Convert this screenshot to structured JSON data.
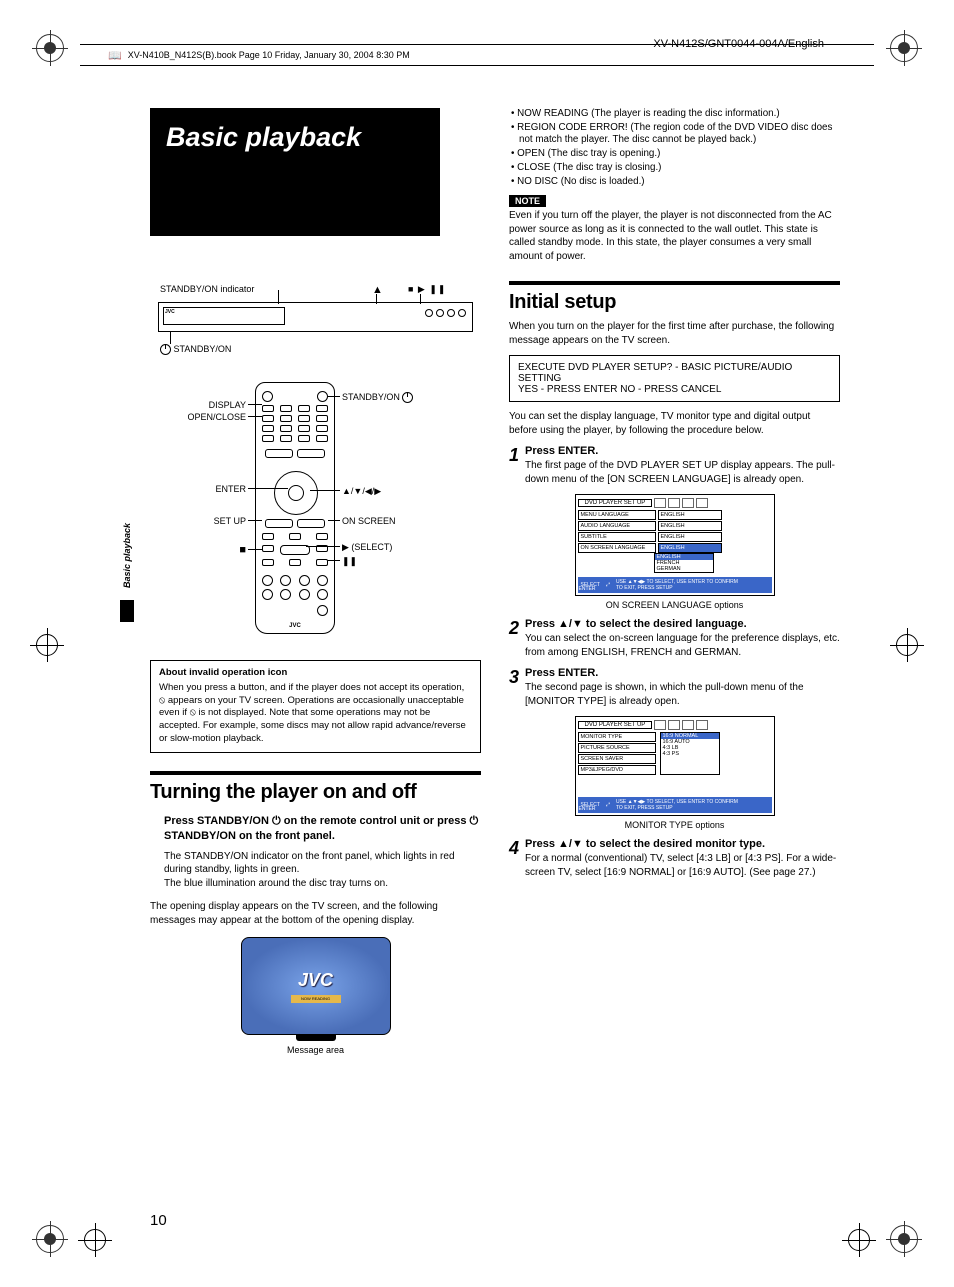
{
  "doc_header": {
    "book_line": "XV-N410B_N412S(B).book  Page 10  Friday, January 30, 2004  8:30 PM",
    "doc_id": "XV-N412S/GNT0044-004A/English"
  },
  "page_number": "10",
  "side_tab": "Basic playback",
  "title_box": "Basic playback",
  "device_labels": {
    "standby_indicator": "STANDBY/ON indicator",
    "eject": "▲",
    "stop_play_pause": "■ ▶ ❚❚",
    "standby_on": "STANDBY/ON",
    "brand": "JVC"
  },
  "remote_labels": {
    "display": "DISPLAY",
    "open_close": "OPEN/CLOSE",
    "enter": "ENTER",
    "set_up": "SET UP",
    "stop": "■",
    "standby_on": "STANDBY/ON",
    "arrows": "▲/▼/◀/▶",
    "on_screen": "ON SCREEN",
    "select": "▶ (SELECT)",
    "pause": "❚❚",
    "brand": "JVC"
  },
  "invalid_box": {
    "title": "About invalid operation icon",
    "body": "When you press a button, and if the player does not accept its operation, ⦸ appears on your TV screen. Operations are occasionally unacceptable even if ⦸ is not displayed. Note that some operations may not be accepted. For example, some discs may not allow rapid advance/reverse or slow-motion playback."
  },
  "turning": {
    "heading": "Turning the player on and off",
    "press_line": "Press STANDBY/ON ⏻ on the remote control unit or press ⏻ STANDBY/ON on the front panel.",
    "body1": "The STANDBY/ON indicator on the front panel, which lights in red during standby, lights in green.",
    "body2": "The blue illumination around the disc tray turns on.",
    "body3": "The opening display appears on the TV screen, and the following messages may appear at the bottom of the opening display.",
    "tv_logo": "JVC",
    "tv_msg": "NOW READING",
    "tv_caption": "Message area"
  },
  "right_bullets": [
    "NOW READING (The player is reading the disc information.)",
    "REGION CODE ERROR! (The region code of the DVD VIDEO disc does not match the player. The disc cannot be played back.)",
    "OPEN (The disc tray is opening.)",
    "CLOSE (The disc tray is closing.)",
    "NO DISC (No disc is loaded.)"
  ],
  "note": {
    "tag": "NOTE",
    "body": "Even if you turn off the player, the player is not disconnected from the AC power source as long as it is connected to the wall outlet. This state is called standby mode. In this state, the player consumes a very small amount of power."
  },
  "initial": {
    "heading": "Initial setup",
    "intro": "When you turn on the player for the first time after purchase, the following message appears on the TV screen.",
    "prompt_l1": "EXECUTE DVD PLAYER SETUP? - BASIC PICTURE/AUDIO SETTING",
    "prompt_l2": "YES - PRESS ENTER   NO - PRESS CANCEL",
    "after_prompt": "You can set the display language, TV monitor type and digital output before using the player, by following the procedure below."
  },
  "steps": {
    "s1": {
      "num": "1",
      "head": "Press ENTER.",
      "body": "The first page of the DVD PLAYER SET UP display appears. The pull-down menu of the [ON SCREEN LANGUAGE] is already open."
    },
    "s2": {
      "num": "2",
      "head": "Press ▲/▼ to select the desired language.",
      "body": "You can select the on-screen language for the preference displays, etc. from among ENGLISH, FRENCH and GERMAN."
    },
    "s3": {
      "num": "3",
      "head": "Press ENTER.",
      "body": "The second page is shown, in which the pull-down menu of the [MONITOR TYPE] is already open."
    },
    "s4": {
      "num": "4",
      "head": "Press ▲/▼ to select the desired monitor type.",
      "body": "For a normal (conventional) TV, select [4:3 LB] or [4:3 PS]. For a wide-screen TV, select [16:9 NORMAL] or [16:9 AUTO]. (See page 27.)"
    }
  },
  "osd1": {
    "title": "DVD PLAYER SET UP",
    "rows_l": [
      "MENU LANGUAGE",
      "AUDIO LANGUAGE",
      "SUBTITLE",
      "ON SCREEN LANGUAGE"
    ],
    "rows_r": [
      "ENGLISH",
      "ENGLISH",
      "ENGLISH",
      "ENGLISH"
    ],
    "drop": [
      "ENGLISH",
      "FRENCH",
      "GERMAN"
    ],
    "foot_l": "SELECT",
    "foot_r1": "USE ▲▼◀▶ TO SELECT, USE ENTER TO CONFIRM",
    "foot_r2": "TO EXIT, PRESS SETUP",
    "foot_enter": "ENTER",
    "caption": "ON SCREEN LANGUAGE options"
  },
  "osd2": {
    "title": "DVD PLAYER SET UP",
    "rows_l": [
      "MONITOR TYPE",
      "PICTURE SOURCE",
      "SCREEN SAVER",
      "MP3&JPEG/DVD"
    ],
    "drop": [
      "16:9 NORMAL",
      "16:9 AUTO",
      "4:3 LB",
      "4:3 PS"
    ],
    "foot_l": "SELECT",
    "foot_r1": "USE ▲▼◀▶ TO SELECT, USE ENTER TO CONFIRM",
    "foot_r2": "TO EXIT, PRESS SETUP",
    "foot_enter": "ENTER",
    "caption": "MONITOR TYPE options"
  }
}
